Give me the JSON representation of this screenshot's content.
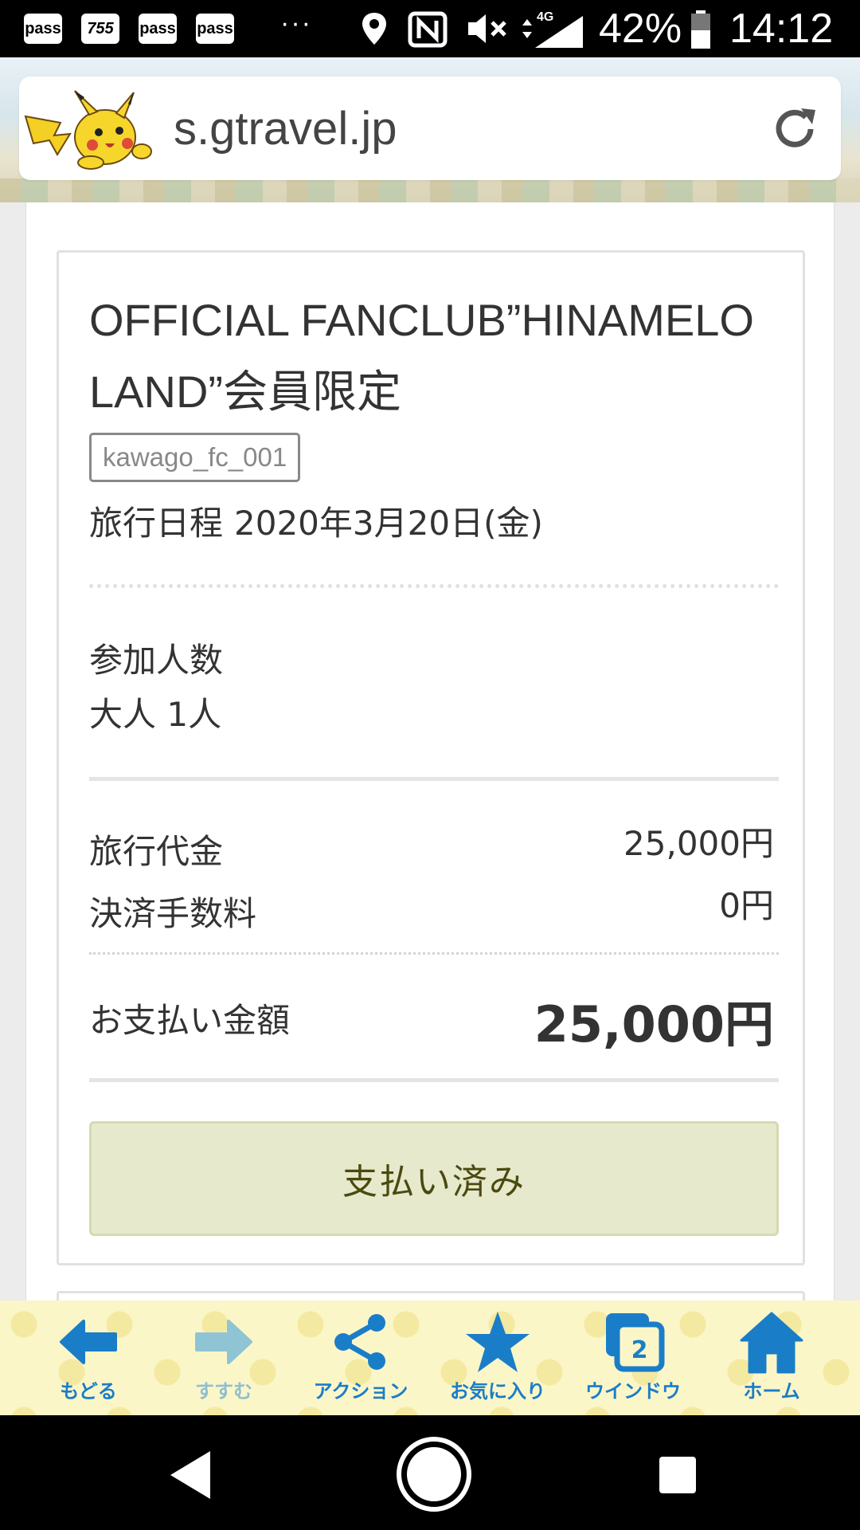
{
  "status_bar": {
    "notifications": [
      "pass",
      "755",
      "pass",
      "pass"
    ],
    "more_indicator": "···",
    "network": "4G",
    "battery": "42%",
    "time": "14:12",
    "icons": [
      "location-icon",
      "nfc-icon",
      "mute-icon",
      "data-arrows-icon",
      "signal-icon",
      "battery-icon"
    ]
  },
  "browser": {
    "url": "s.gtravel.jp",
    "logo_icon": "pikachu-logo",
    "reload_icon": "reload-icon"
  },
  "booking": {
    "title": "OFFICIAL FANCLUB”HINAMELO LAND”会員限定",
    "code": "kawago_fc_001",
    "date_label": "旅行日程",
    "date_value": "2020年3月20日(金)",
    "pax_label": "参加人数",
    "pax_value": "大人 1人",
    "fee_label": "旅行代金",
    "fee_value": "25,000円",
    "payment_fee_label": "決済手数料",
    "payment_fee_value": "0円",
    "total_label": "お支払い金額",
    "total_value": "25,000円",
    "status_button": "支払い済み"
  },
  "toolbar": {
    "items": [
      {
        "label": "もどる",
        "icon": "back-arrow-icon",
        "enabled": true
      },
      {
        "label": "すすむ",
        "icon": "forward-arrow-icon",
        "enabled": false
      },
      {
        "label": "アクション",
        "icon": "share-icon",
        "enabled": true
      },
      {
        "label": "お気に入り",
        "icon": "star-icon",
        "enabled": true
      },
      {
        "label": "ウインドウ",
        "icon": "windows-icon",
        "enabled": true,
        "badge": "2"
      },
      {
        "label": "ホーム",
        "icon": "home-icon",
        "enabled": true
      }
    ],
    "accent": "#1a7dc8",
    "background": "#fbf6c8"
  },
  "nav_bar": {
    "buttons": [
      "back-triangle-icon",
      "home-circle-icon",
      "recents-square-icon"
    ]
  }
}
